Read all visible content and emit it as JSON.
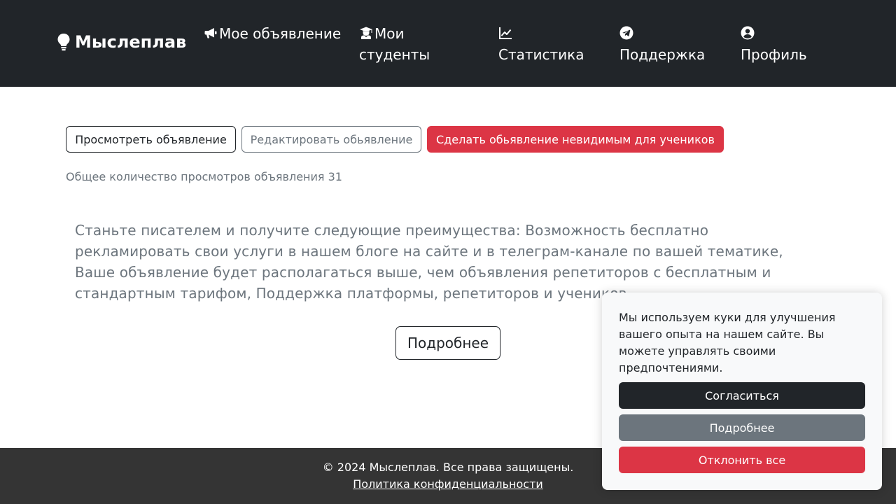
{
  "header": {
    "brand": "Мыслеплав",
    "nav": [
      {
        "label": "Мое объявление",
        "icon": "megaphone-icon"
      },
      {
        "label": "Мои студенты",
        "icon": "graduate-icon"
      },
      {
        "label": "Статистика",
        "icon": "chart-line-icon"
      },
      {
        "label": "Поддержка",
        "icon": "telegram-icon"
      },
      {
        "label": "Профиль",
        "icon": "user-circle-icon"
      }
    ]
  },
  "actions": {
    "view": "Просмотреть объявление",
    "edit": "Редактировать обьявление",
    "hide": "Сделать обьявление невидимым для учеников"
  },
  "stats": {
    "views_text": "Общее количество просмотров объявления 31"
  },
  "promo": {
    "text": "Станьте писателем и получите следующие преимущества: Возможность бесплатно рекламировать свои услуги в нашем блоге на сайте и в телеграм-канале по вашей тематике, Ваше объявление будет располагаться выше, чем объявления репетиторов с бесплатным и стандартным тарифом, Поддержка платформы, репетиторов и учеников.",
    "more_label": "Подробнее"
  },
  "footer": {
    "copyright": "© 2024 Мыслеплав. Все права защищены.",
    "policy": "Политика конфиденциальности"
  },
  "cookie": {
    "message": "Мы используем куки для улучшения вашего опыта на нашем сайте. Вы можете управлять своими предпочтениями.",
    "accept": "Согласиться",
    "more": "Подробнее",
    "reject": "Отклонить все"
  },
  "colors": {
    "navbar": "#212529",
    "danger": "#dc3545",
    "secondary": "#6c757d",
    "footer": "#343434",
    "cookie_bg": "#f8f9fa"
  }
}
